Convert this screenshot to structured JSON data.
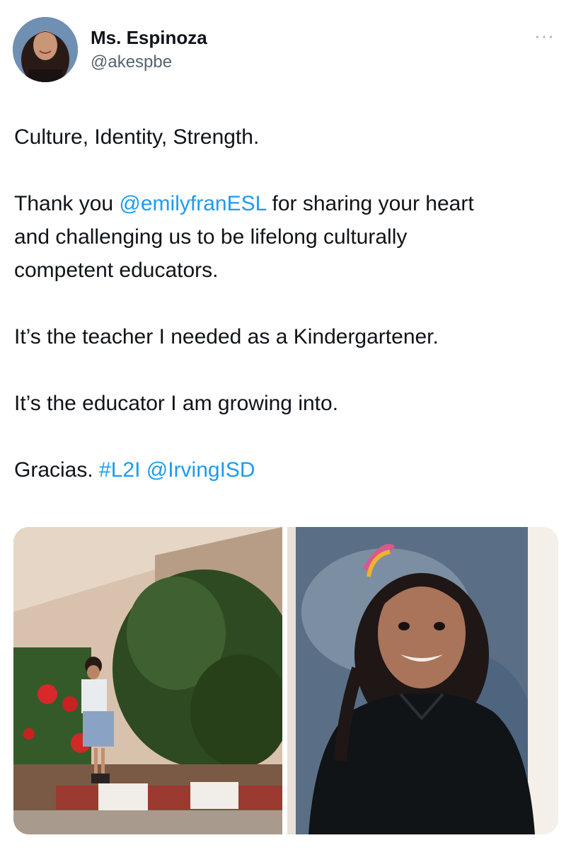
{
  "author": {
    "display_name": "Ms. Espinoza",
    "handle": "@akespbe",
    "avatar_icon": "profile-photo"
  },
  "more_menu": {
    "icon": "more-options-icon",
    "glyph": "···"
  },
  "tweet": {
    "line1": "Culture, Identity, Strength.",
    "para2_prefix": "Thank you ",
    "mention1": "@emilyfranESL",
    "para2_line1_suffix": " for sharing your heart",
    "para2_line2": "and challenging us to be lifelong culturally",
    "para2_line3": "competent educators.",
    "para3": "It’s the teacher I needed as a Kindergartener.",
    "para4": "It’s the educator I am growing into.",
    "para5_prefix": "Gracias. ",
    "hashtag": "#L2I",
    "mention2": "@IrvingISD"
  },
  "colors": {
    "link": "#1d9bf0",
    "text": "#0f1419",
    "secondary": "#536471"
  }
}
